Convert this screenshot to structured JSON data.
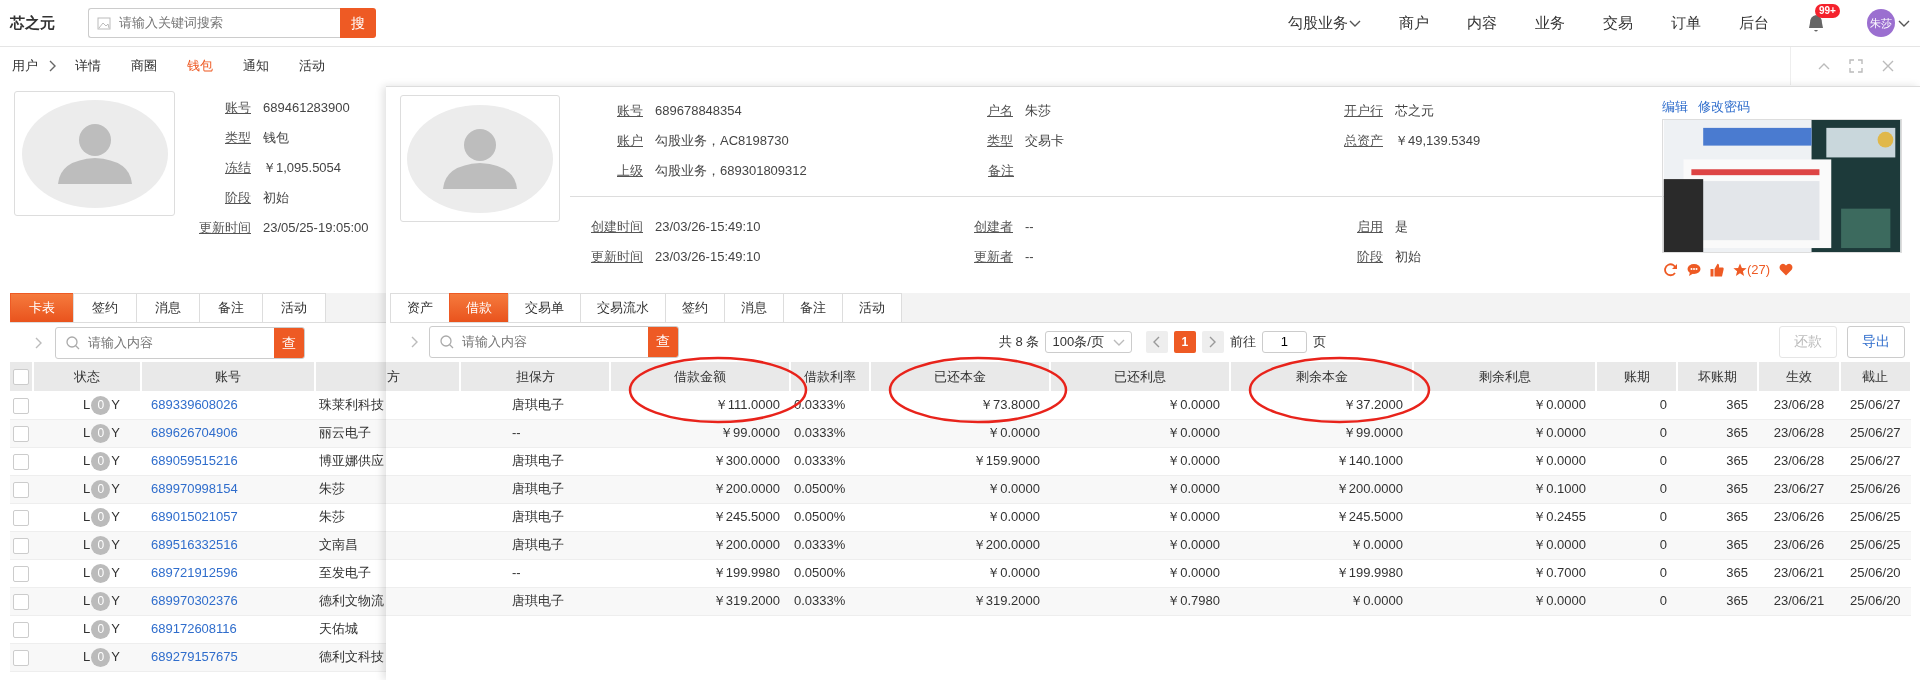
{
  "header": {
    "logo": "芯之元",
    "search": {
      "placeholder": "请输入关键词搜索",
      "button": "搜"
    },
    "nav": [
      {
        "label": "勾股业务",
        "dropdown": true
      },
      {
        "label": "商户",
        "dropdown": false
      },
      {
        "label": "内容",
        "dropdown": false
      },
      {
        "label": "业务",
        "dropdown": false
      },
      {
        "label": "交易",
        "dropdown": false
      },
      {
        "label": "订单",
        "dropdown": false
      },
      {
        "label": "后台",
        "dropdown": false
      }
    ],
    "notifications": {
      "badge": "99+"
    },
    "user": {
      "avatar_text": "朱莎"
    }
  },
  "subnav": {
    "root": "用户",
    "items": [
      {
        "label": "详情",
        "selected": false
      },
      {
        "label": "商圈",
        "selected": false
      },
      {
        "label": "钱包",
        "selected": true
      },
      {
        "label": "通知",
        "selected": false
      },
      {
        "label": "活动",
        "selected": false
      }
    ]
  },
  "wallet": {
    "fields": [
      {
        "label": "账号",
        "value": "689461283900"
      },
      {
        "label": "类型",
        "value": "钱包"
      },
      {
        "label": "冻结",
        "value": "￥1,095.5054"
      },
      {
        "label": "阶段",
        "value": "初始"
      },
      {
        "label": "更新时间",
        "value": "23/05/25-19:05:00"
      }
    ],
    "tabs": [
      {
        "label": "卡表",
        "selected": true
      },
      {
        "label": "签约",
        "selected": false
      },
      {
        "label": "消息",
        "selected": false
      },
      {
        "label": "备注",
        "selected": false
      },
      {
        "label": "活动",
        "selected": false
      }
    ],
    "search": {
      "placeholder": "请输入内容",
      "button": "查"
    },
    "table": {
      "header_checked": false,
      "columns": [
        "状态",
        "账号"
      ],
      "rows": [
        {
          "checked": false,
          "status_left": "L",
          "status_count": "0",
          "status_right": "Y",
          "account": "689339608026",
          "column_4": "珠莱利科技"
        },
        {
          "checked": false,
          "status_left": "L",
          "status_count": "0",
          "status_right": "Y",
          "account": "689626704906",
          "column_4": "丽云电子"
        },
        {
          "checked": false,
          "status_left": "L",
          "status_count": "0",
          "status_right": "Y",
          "account": "689059515216",
          "column_4": "博亚娜供应"
        },
        {
          "checked": false,
          "status_left": "L",
          "status_count": "0",
          "status_right": "Y",
          "account": "689970998154",
          "column_4": "朱莎"
        },
        {
          "checked": false,
          "status_left": "L",
          "status_count": "0",
          "status_right": "Y",
          "account": "689015021057",
          "column_4": "朱莎"
        },
        {
          "checked": false,
          "status_left": "L",
          "status_count": "0",
          "status_right": "Y",
          "account": "689516332516",
          "column_4": "文南昌"
        },
        {
          "checked": false,
          "status_left": "L",
          "status_count": "0",
          "status_right": "Y",
          "account": "689721912596",
          "column_4": "至发电子"
        },
        {
          "checked": false,
          "status_left": "L",
          "status_count": "0",
          "status_right": "Y",
          "account": "689970302376",
          "column_4": "德利文物流"
        },
        {
          "checked": false,
          "status_left": "L",
          "status_count": "0",
          "status_right": "Y",
          "account": "689172608116",
          "column_4": "天佑城"
        },
        {
          "checked": false,
          "status_left": "L",
          "status_count": "0",
          "status_right": "Y",
          "account": "689279157675",
          "column_4": "德利文科技"
        }
      ]
    }
  },
  "card_detail": {
    "info_groups": [
      [
        [
          {
            "label": "账号",
            "value": "689678848354"
          },
          {
            "label": "户名",
            "value": "朱莎"
          },
          {
            "label": "开户行",
            "value": "芯之元"
          }
        ],
        [
          {
            "label": "账户",
            "value": "勾股业务，AC8198730"
          },
          {
            "label": "类型",
            "value": "交易卡"
          },
          {
            "label": "总资产",
            "value": "￥49,139.5349"
          }
        ],
        [
          {
            "label": "上级",
            "value": "勾股业务，689301809312"
          },
          {
            "label": "备注"
          }
        ]
      ],
      [
        [
          {
            "label": "创建时间",
            "value": "23/03/26-15:49:10"
          },
          {
            "label": "创建者",
            "value": "--"
          },
          {
            "label": "启用",
            "value": "是"
          }
        ],
        [
          {
            "label": "更新时间",
            "value": "23/03/26-15:49:10"
          },
          {
            "label": "更新者",
            "value": "--"
          },
          {
            "label": "阶段",
            "value": "初始"
          }
        ]
      ]
    ],
    "links": [
      "编辑",
      "修改密码"
    ],
    "picture": {
      "kind": "picture"
    },
    "rating_count": "(27)",
    "tabs": [
      {
        "label": "资产",
        "selected": false
      },
      {
        "label": "借款",
        "selected": true
      },
      {
        "label": "交易单",
        "selected": false
      },
      {
        "label": "交易流水",
        "selected": false
      },
      {
        "label": "签约",
        "selected": false
      },
      {
        "label": "消息",
        "selected": false
      },
      {
        "label": "备注",
        "selected": false
      },
      {
        "label": "活动",
        "selected": false
      }
    ],
    "search": {
      "placeholder": "请输入内容",
      "button": "查"
    },
    "pagination": {
      "total": "共 8 条",
      "page_size": "100条/页",
      "pages": [
        {
          "label": "1",
          "selected": true
        }
      ],
      "goto_label": "前往",
      "goto_value": "1",
      "page_suffix": "页"
    },
    "buttons": [
      {
        "label": "还款",
        "disabled": true
      },
      {
        "label": "导出",
        "disabled": false
      }
    ],
    "table": {
      "partial_column": "方",
      "columns": [
        {
          "label": "担保方",
          "highlighted": false
        },
        {
          "label": "借款金额",
          "highlighted": true
        },
        {
          "label": "借款利率",
          "highlighted": false
        },
        {
          "label": "已还本金",
          "highlighted": true
        },
        {
          "label": "已还利息",
          "highlighted": false
        },
        {
          "label": "剩余本金",
          "highlighted": true
        },
        {
          "label": "剩余利息",
          "highlighted": false
        },
        {
          "label": "账期",
          "highlighted": false
        },
        {
          "label": "坏账期",
          "highlighted": false
        },
        {
          "label": "生效",
          "highlighted": false
        },
        {
          "label": "截止",
          "highlighted": false
        }
      ],
      "rows": [
        [
          "唐琪电子",
          "￥111.0000",
          "0.0333%",
          "￥73.8000",
          "￥0.0000",
          "￥37.2000",
          "￥0.0000",
          "0",
          "365",
          "23/06/28",
          "25/06/27"
        ],
        [
          "--",
          "￥99.0000",
          "0.0333%",
          "￥0.0000",
          "￥0.0000",
          "￥99.0000",
          "￥0.0000",
          "0",
          "365",
          "23/06/28",
          "25/06/27"
        ],
        [
          "唐琪电子",
          "￥300.0000",
          "0.0333%",
          "￥159.9000",
          "￥0.0000",
          "￥140.1000",
          "￥0.0000",
          "0",
          "365",
          "23/06/28",
          "25/06/27"
        ],
        [
          "唐琪电子",
          "￥200.0000",
          "0.0500%",
          "￥0.0000",
          "￥0.0000",
          "￥200.0000",
          "￥0.1000",
          "0",
          "365",
          "23/06/27",
          "25/06/26"
        ],
        [
          "唐琪电子",
          "￥245.5000",
          "0.0500%",
          "￥0.0000",
          "￥0.0000",
          "￥245.5000",
          "￥0.2455",
          "0",
          "365",
          "23/06/26",
          "25/06/25"
        ],
        [
          "唐琪电子",
          "￥200.0000",
          "0.0333%",
          "￥200.0000",
          "￥0.0000",
          "￥0.0000",
          "￥0.0000",
          "0",
          "365",
          "23/06/26",
          "25/06/25"
        ],
        [
          "--",
          "￥199.9980",
          "0.0500%",
          "￥0.0000",
          "￥0.0000",
          "￥199.9980",
          "￥0.7000",
          "0",
          "365",
          "23/06/21",
          "25/06/20"
        ],
        [
          "唐琪电子",
          "￥319.2000",
          "0.0333%",
          "￥319.2000",
          "￥0.7980",
          "￥0.0000",
          "￥0.0000",
          "0",
          "365",
          "23/06/21",
          "25/06/20"
        ]
      ]
    }
  }
}
